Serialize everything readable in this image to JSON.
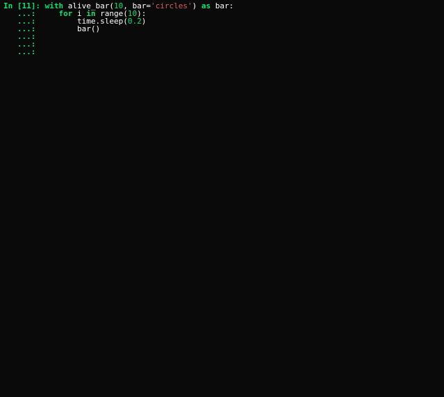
{
  "prompt": {
    "in_label": "In ",
    "open_bracket": "[",
    "cell_number": "11",
    "close_bracket": "]: ",
    "continuation": "   ...: "
  },
  "code": {
    "line1": {
      "kw_with": "with",
      "sp1": " ",
      "func": "alive_bar",
      "lparen": "(",
      "arg_num": "10",
      "comma_sp": ", ",
      "param": "bar",
      "eq": "=",
      "str": "'circles'",
      "rparen": ")",
      "sp2": " ",
      "kw_as": "as",
      "sp3": " ",
      "var": "bar",
      "colon": ":"
    },
    "line2": {
      "indent": "    ",
      "kw_for": "for",
      "sp1": " ",
      "var_i": "i",
      "sp2": " ",
      "kw_in": "in",
      "sp3": " ",
      "func": "range",
      "lparen": "(",
      "num": "10",
      "rparen": ")",
      "colon": ":"
    },
    "line3": {
      "indent": "        ",
      "mod": "time",
      "dot": ".",
      "func": "sleep",
      "lparen": "(",
      "num": "0.2",
      "rparen": ")"
    },
    "line4": {
      "indent": "        ",
      "func": "bar",
      "lparen": "(",
      "rparen": ")"
    },
    "blank_cont_count": 3
  }
}
